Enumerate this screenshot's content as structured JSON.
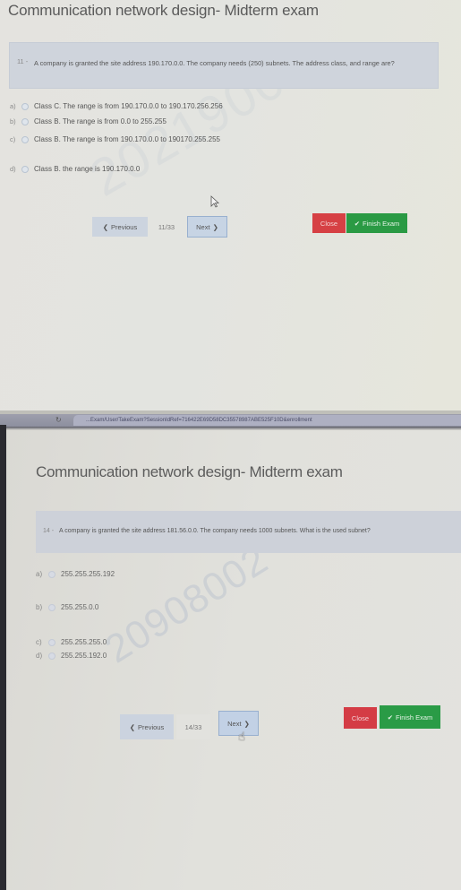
{
  "screens": [
    {
      "title": "Communication network design- Midterm exam",
      "question": {
        "number": "11 -",
        "text": "A company is granted the site address 190.170.0.0. The company needs (250) subnets. The address class, and range are?"
      },
      "options": [
        {
          "letter": "a)",
          "text": "Class C. The range is from 190.170.0.0 to 190.170.256.256"
        },
        {
          "letter": "b)",
          "text": "Class B. The range is from 0.0 to 255.255"
        },
        {
          "letter": "c)",
          "text": "Class B. The range is from 190.170.0.0 to 190170.255.255"
        },
        {
          "letter": "d)",
          "text": "Class B. the range is 190.170.0.0"
        }
      ],
      "nav": {
        "previous_label": "Previous",
        "previous_icon": "chevron-left",
        "counter": "11/33",
        "next_label": "Next",
        "next_icon": "chevron-right",
        "close_label": "Close",
        "finish_label": "Finish Exam",
        "finish_icon": "checkmark"
      },
      "cursor": "arrow-pointer",
      "watermark": "2021900"
    },
    {
      "browser": {
        "url": "...Exam/User/TakeExam?SessionIdRef=716422E69D58DC35578987ABE525F10D&enrollment"
      },
      "title": "Communication network design- Midterm exam",
      "question": {
        "number": "14 -",
        "text": "A company is granted the site address 181.56.0.0. The company needs 1000 subnets. What is the used subnet?"
      },
      "options": [
        {
          "letter": "a)",
          "text": "255.255.255.192"
        },
        {
          "letter": "b)",
          "text": "255.255.0.0"
        },
        {
          "letter": "c)",
          "text": "255.255.255.0"
        },
        {
          "letter": "d)",
          "text": "255.255.192.0"
        }
      ],
      "nav": {
        "previous_label": "Previous",
        "previous_icon": "chevron-left",
        "counter": "14/33",
        "next_label": "Next",
        "next_icon": "chevron-right",
        "close_label": "Close",
        "finish_label": "Finish Exam",
        "finish_icon": "checkmark"
      },
      "cursor": "hand-pointer",
      "watermark": "20908002"
    }
  ],
  "colors": {
    "close_button": "#d64044",
    "finish_button": "#2a9a44",
    "next_button": "#c7d4e4",
    "previous_button": "#ccd4df",
    "question_bar": "#cfd4dc"
  }
}
